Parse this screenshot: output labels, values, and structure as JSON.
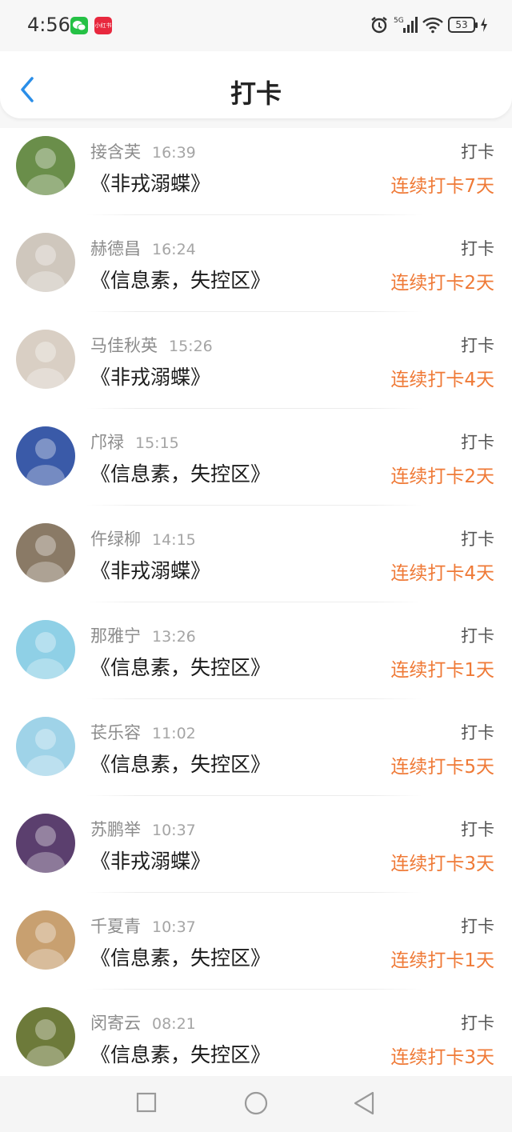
{
  "status": {
    "time": "4:56",
    "wechat_badge": "",
    "xhs_badge": "小红书",
    "battery": "53"
  },
  "header": {
    "title": "打卡"
  },
  "entries": [
    {
      "name": "接含芙",
      "time": "16:39",
      "book": "《非戎溺蝶》",
      "action": "打卡",
      "streak": "连续打卡7天",
      "avatar_color": "#6a8e4a"
    },
    {
      "name": "赫德昌",
      "time": "16:24",
      "book": "《信息素，失控区》",
      "action": "打卡",
      "streak": "连续打卡2天",
      "avatar_color": "#cfc7bd"
    },
    {
      "name": "马佳秋英",
      "time": "15:26",
      "book": "《非戎溺蝶》",
      "action": "打卡",
      "streak": "连续打卡4天",
      "avatar_color": "#d9cfc4"
    },
    {
      "name": "邝禄",
      "time": "15:15",
      "book": "《信息素，失控区》",
      "action": "打卡",
      "streak": "连续打卡2天",
      "avatar_color": "#3a5aa8"
    },
    {
      "name": "仵绿柳",
      "time": "14:15",
      "book": "《非戎溺蝶》",
      "action": "打卡",
      "streak": "连续打卡4天",
      "avatar_color": "#8a7a66"
    },
    {
      "name": "那雅宁",
      "time": "13:26",
      "book": "《信息素，失控区》",
      "action": "打卡",
      "streak": "连续打卡1天",
      "avatar_color": "#8fd0e6"
    },
    {
      "name": "苌乐容",
      "time": "11:02",
      "book": "《信息素，失控区》",
      "action": "打卡",
      "streak": "连续打卡5天",
      "avatar_color": "#9fd3e8"
    },
    {
      "name": "苏鹏举",
      "time": "10:37",
      "book": "《非戎溺蝶》",
      "action": "打卡",
      "streak": "连续打卡3天",
      "avatar_color": "#5b3f6e"
    },
    {
      "name": "千夏青",
      "time": "10:37",
      "book": "《信息素，失控区》",
      "action": "打卡",
      "streak": "连续打卡1天",
      "avatar_color": "#c8a070"
    },
    {
      "name": "闵寄云",
      "time": "08:21",
      "book": "《信息素，失控区》",
      "action": "打卡",
      "streak": "连续打卡3天",
      "avatar_color": "#6d7a3a"
    }
  ],
  "colors": {
    "accent": "#2a8ee8",
    "streak": "#ef7a37"
  }
}
